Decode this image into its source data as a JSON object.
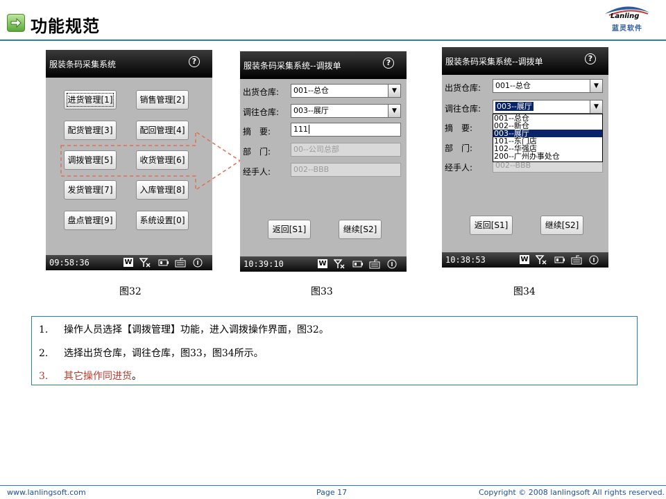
{
  "header": {
    "title": "功能规范",
    "logo_en": "Lanling",
    "logo_cn": "蓝灵软件"
  },
  "screens": {
    "s32": {
      "title": "服装条码采集系统",
      "time": "09:58:36",
      "buttons": [
        "进货管理[1]",
        "销售管理[2]",
        "配货管理[3]",
        "配回管理[4]",
        "调拨管理[5]",
        "收货管理[6]",
        "发货管理[7]",
        "入库管理[8]",
        "盘点管理[9]",
        "系统设置[0]"
      ]
    },
    "s33": {
      "title": "服装条码采集系统--调拨单",
      "time": "10:39:10",
      "label_from": "出货仓库:",
      "label_to": "调往仓库:",
      "label_summary": "摘　要:",
      "label_dept": "部　门:",
      "label_handler": "经手人:",
      "from": "001--总仓",
      "to": "003--展厅",
      "summary": "111",
      "dept": "00--公司总部",
      "handler": "002--BBB",
      "back": "返回[S1]",
      "next": "继续[S2]"
    },
    "s34": {
      "title": "服装条码采集系统--调拨单",
      "time": "10:38:53",
      "label_from": "出货仓库:",
      "label_to": "调往仓库:",
      "label_summary": "摘　要:",
      "label_dept": "部　门:",
      "label_handler": "经手人:",
      "from": "001--总仓",
      "to": "003--展厅",
      "options": [
        "001--总仓",
        "002--新仓",
        "003--展厅",
        "101--东门店",
        "102--华强店",
        "200--广州办事处仓"
      ],
      "handler_partial": "002--BBB",
      "back": "返回[S1]",
      "next": "继续[S2]"
    }
  },
  "captions": [
    "图32",
    "图33",
    "图34"
  ],
  "steps": [
    {
      "num": "1.",
      "text": "操作人员选择【调拨管理】功能，进入调拨操作界面，图32。"
    },
    {
      "num": "2.",
      "text": "选择出货仓库，调往仓库，图33，图34所示。"
    },
    {
      "num": "3.",
      "text": "其它操作同进货",
      "tail": "。"
    }
  ],
  "footer": {
    "left": "www.lanlingsoft.com",
    "center": "Page 17",
    "right": "Copyright © 2008 lanlingsoft All rights reserved."
  },
  "colors": {
    "accent": "#2a7fa8",
    "arrow": "#e07050",
    "highlight": "#0a246a",
    "step3": "#c0392b"
  }
}
